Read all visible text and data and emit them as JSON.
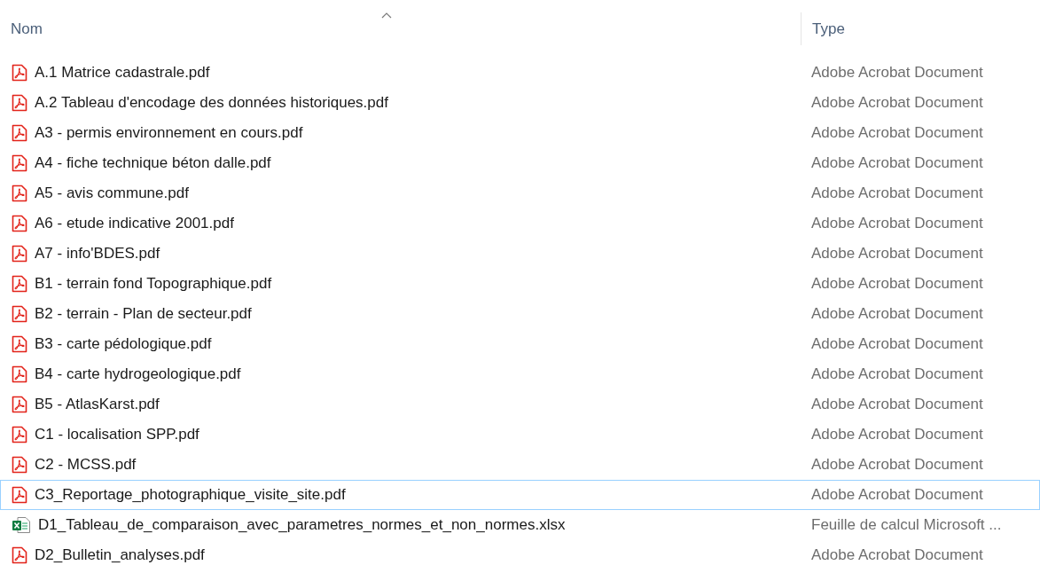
{
  "columns": [
    {
      "label": "Nom",
      "sorted": true
    },
    {
      "label": "Type",
      "sorted": false
    }
  ],
  "rows": [
    {
      "kind": "pdf",
      "name": "A.1 Matrice cadastrale.pdf",
      "type": "Adobe Acrobat Document",
      "focused": false
    },
    {
      "kind": "pdf",
      "name": "A.2 Tableau d'encodage des données historiques.pdf",
      "type": "Adobe Acrobat Document",
      "focused": false
    },
    {
      "kind": "pdf",
      "name": "A3 - permis environnement en cours.pdf",
      "type": "Adobe Acrobat Document",
      "focused": false
    },
    {
      "kind": "pdf",
      "name": "A4 - fiche technique béton dalle.pdf",
      "type": "Adobe Acrobat Document",
      "focused": false
    },
    {
      "kind": "pdf",
      "name": "A5 - avis commune.pdf",
      "type": "Adobe Acrobat Document",
      "focused": false
    },
    {
      "kind": "pdf",
      "name": "A6 - etude indicative 2001.pdf",
      "type": "Adobe Acrobat Document",
      "focused": false
    },
    {
      "kind": "pdf",
      "name": "A7 - info'BDES.pdf",
      "type": "Adobe Acrobat Document",
      "focused": false
    },
    {
      "kind": "pdf",
      "name": "B1 - terrain fond Topographique.pdf",
      "type": "Adobe Acrobat Document",
      "focused": false
    },
    {
      "kind": "pdf",
      "name": "B2 - terrain - Plan de secteur.pdf",
      "type": "Adobe Acrobat Document",
      "focused": false
    },
    {
      "kind": "pdf",
      "name": "B3 - carte pédologique.pdf",
      "type": "Adobe Acrobat Document",
      "focused": false
    },
    {
      "kind": "pdf",
      "name": "B4 - carte hydrogeologique.pdf",
      "type": "Adobe Acrobat Document",
      "focused": false
    },
    {
      "kind": "pdf",
      "name": "B5 - AtlasKarst.pdf",
      "type": "Adobe Acrobat Document",
      "focused": false
    },
    {
      "kind": "pdf",
      "name": "C1 - localisation SPP.pdf",
      "type": "Adobe Acrobat Document",
      "focused": false
    },
    {
      "kind": "pdf",
      "name": "C2 - MCSS.pdf",
      "type": "Adobe Acrobat Document",
      "focused": false
    },
    {
      "kind": "pdf",
      "name": "C3_Reportage_photographique_visite_site.pdf",
      "type": "Adobe Acrobat Document",
      "focused": true
    },
    {
      "kind": "xlsx",
      "name": "D1_Tableau_de_comparaison_avec_parametres_normes_et_non_normes.xlsx",
      "type": "Feuille de calcul Microsoft ...",
      "focused": false
    },
    {
      "kind": "pdf",
      "name": "D2_Bulletin_analyses.pdf",
      "type": "Adobe Acrobat Document",
      "focused": false
    }
  ]
}
